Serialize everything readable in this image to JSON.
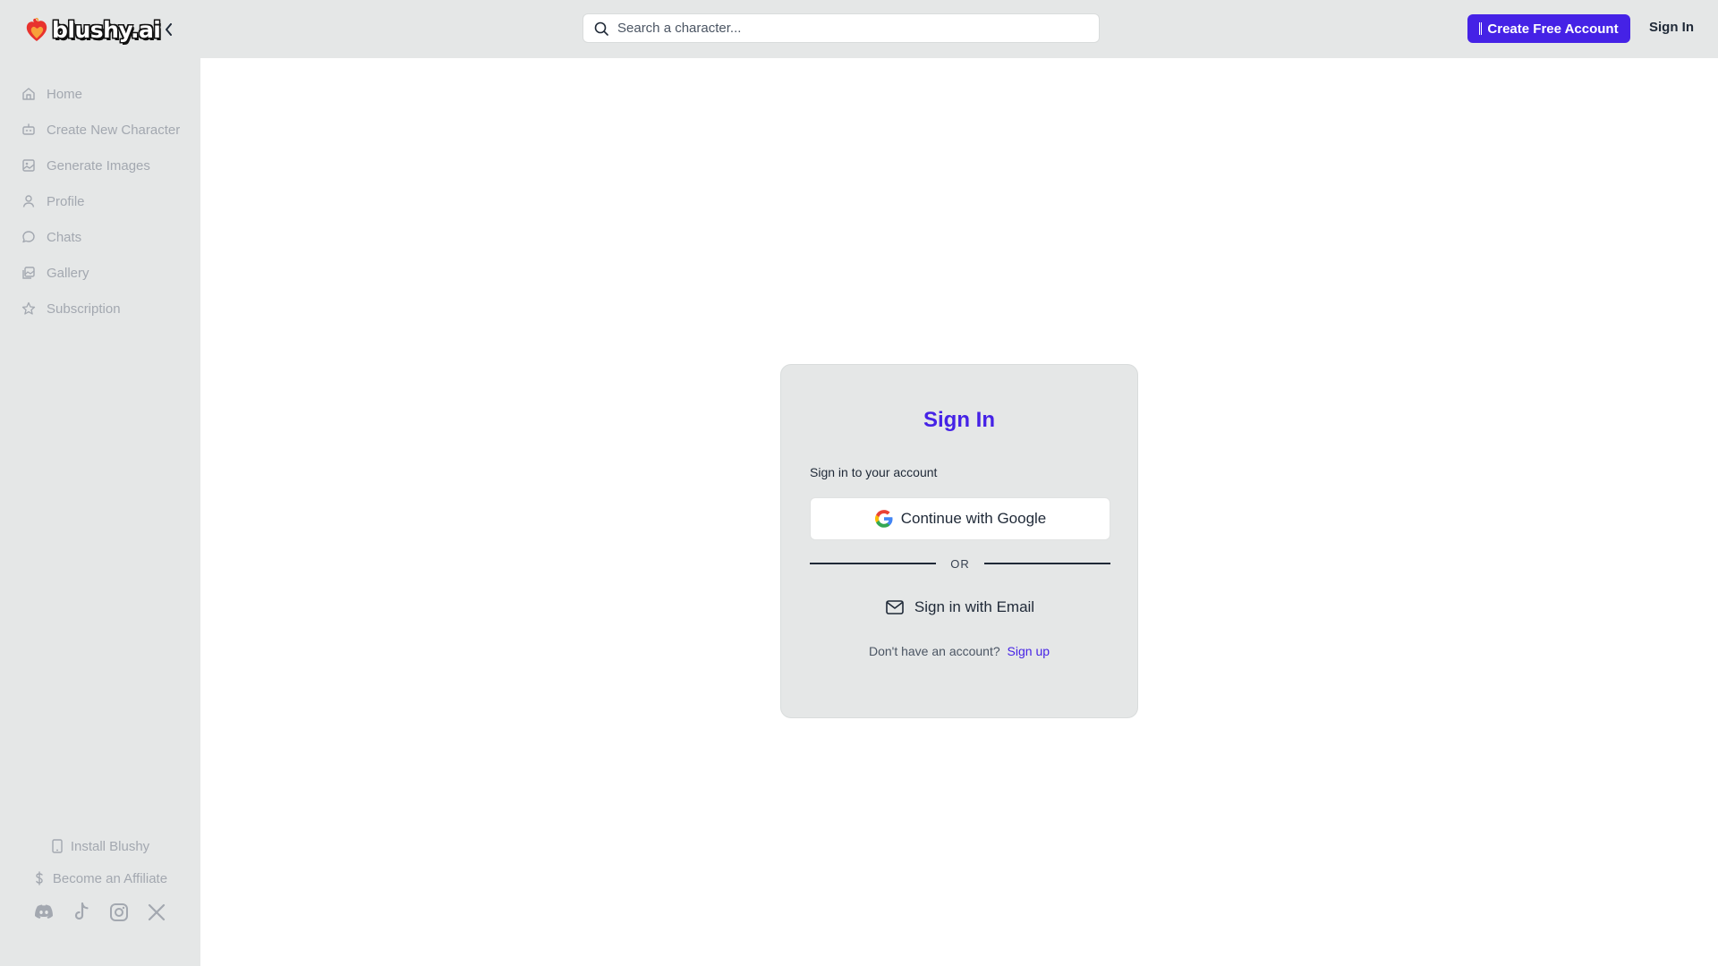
{
  "brand": {
    "name": "blushy.ai",
    "accent": "#4522e6"
  },
  "header": {
    "search_placeholder": "Search a character...",
    "create_account_label": "Create Free Account",
    "sign_in_label": "Sign In"
  },
  "sidebar": {
    "items": [
      {
        "label": "Home",
        "icon": "home-icon"
      },
      {
        "label": "Create New Character",
        "icon": "bot-icon"
      },
      {
        "label": "Generate Images",
        "icon": "image-icon"
      },
      {
        "label": "Profile",
        "icon": "user-icon"
      },
      {
        "label": "Chats",
        "icon": "chat-icon"
      },
      {
        "label": "Gallery",
        "icon": "gallery-icon"
      },
      {
        "label": "Subscription",
        "icon": "star-icon"
      }
    ],
    "install_label": "Install Blushy",
    "affiliate_label": "Become an Affiliate",
    "socials": [
      "discord-icon",
      "tiktok-icon",
      "instagram-icon",
      "x-icon"
    ]
  },
  "signin": {
    "title": "Sign In",
    "subtitle": "Sign in to your account",
    "google_label": "Continue with Google",
    "or_label": "OR",
    "email_label": "Sign in with Email",
    "no_account_text": "Don't have an account?",
    "sign_up_label": "Sign up"
  }
}
